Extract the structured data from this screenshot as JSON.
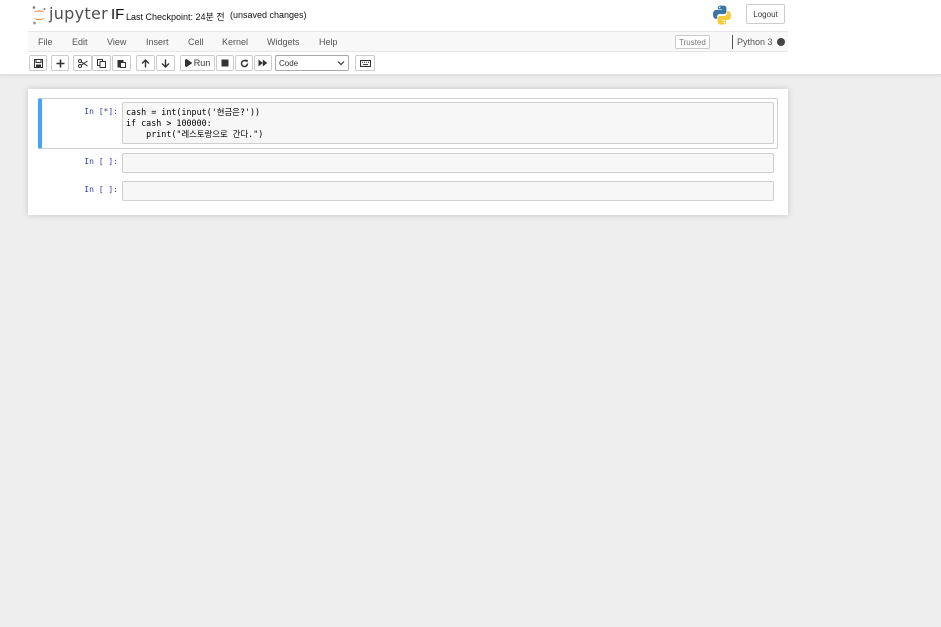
{
  "header": {
    "logo_text": "jupyter",
    "notebook_name": "IF",
    "checkpoint": "Last Checkpoint: 24분 전",
    "autosave_status": "(unsaved changes)",
    "logout_label": "Logout"
  },
  "menubar": {
    "items": [
      "File",
      "Edit",
      "View",
      "Insert",
      "Cell",
      "Kernel",
      "Widgets",
      "Help"
    ],
    "trusted_label": "Trusted",
    "kernel_name": "Python 3"
  },
  "toolbar": {
    "run_label": "Run",
    "cell_type_value": "Code"
  },
  "cells": [
    {
      "prompt": "In [*]:",
      "lines": [
        "cash = int(input('현금은?'))",
        "if cash > 100000:",
        "    print(\"레스토랑으로 간다.\")"
      ]
    },
    {
      "prompt": "In [ ]:",
      "lines": []
    },
    {
      "prompt": "In [ ]:",
      "lines": []
    }
  ],
  "colors": {
    "selected_cell_accent": "#42a5f5",
    "prompt": "#303f9f",
    "logo_orange": "#f37726",
    "kernel_busy_dot": "#444444"
  }
}
